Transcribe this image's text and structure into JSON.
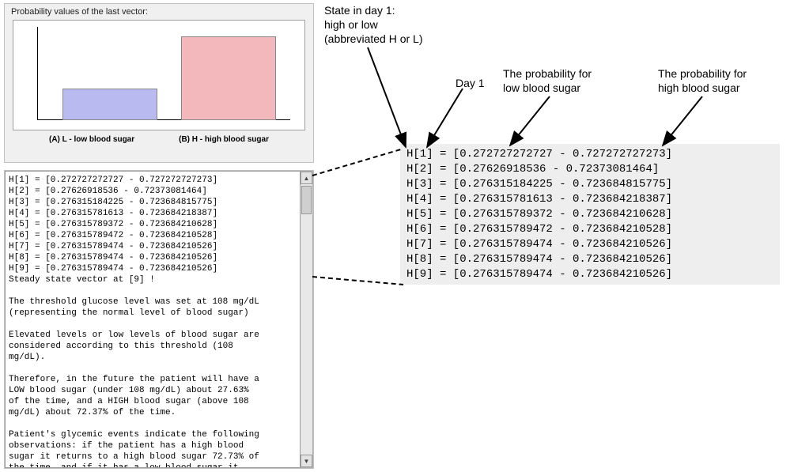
{
  "chart": {
    "title": "Probability values of the last vector:",
    "label_low": "(A) L - low blood sugar",
    "label_high": "(B) H - high blood sugar"
  },
  "chart_data": {
    "type": "bar",
    "categories": [
      "(A) L - low blood sugar",
      "(B) H - high blood sugar"
    ],
    "values": [
      0.2763,
      0.7237
    ],
    "title": "Probability values of the last vector:",
    "xlabel": "",
    "ylabel": "",
    "ylim": [
      0,
      1
    ]
  },
  "log": {
    "text": "H[1] = [0.272727272727 - 0.727272727273]\nH[2] = [0.27626918536 - 0.72373081464]\nH[3] = [0.276315184225 - 0.723684815775]\nH[4] = [0.276315781613 - 0.723684218387]\nH[5] = [0.276315789372 - 0.723684210628]\nH[6] = [0.276315789472 - 0.723684210528]\nH[7] = [0.276315789474 - 0.723684210526]\nH[8] = [0.276315789474 - 0.723684210526]\nH[9] = [0.276315789474 - 0.723684210526]\nSteady state vector at [9] !\n\nThe threshold glucose level was set at 108 mg/dL\n(representing the normal level of blood sugar)\n\nElevated levels or low levels of blood sugar are\nconsidered according to this threshold (108\nmg/dL).\n\nTherefore, in the future the patient will have a\nLOW blood sugar (under 108 mg/dL) about 27.63%\nof the time, and a HIGH blood sugar (above 108\nmg/dL) about 72.37% of the time.\n\nPatient's glycemic events indicate the following\nobservations: if the patient has a high blood\nsugar it returns to a high blood sugar 72.73% of\nthe time, and if it has a low blood sugar it"
  },
  "zoom": {
    "text": "H[1] = [0.272727272727 - 0.727272727273]\nH[2] = [0.27626918536 - 0.72373081464]\nH[3] = [0.276315184225 - 0.723684815775]\nH[4] = [0.276315781613 - 0.723684218387]\nH[5] = [0.276315789372 - 0.723684210628]\nH[6] = [0.276315789472 - 0.723684210528]\nH[7] = [0.276315789474 - 0.723684210526]\nH[8] = [0.276315789474 - 0.723684210526]\nH[9] = [0.276315789474 - 0.723684210526]"
  },
  "annotations": {
    "state": "State in day 1:\nhigh or low\n(abbreviated H or L)",
    "day1": "Day 1",
    "low": "The probability for\nlow blood sugar",
    "high": "The probability for\nhigh blood sugar"
  }
}
